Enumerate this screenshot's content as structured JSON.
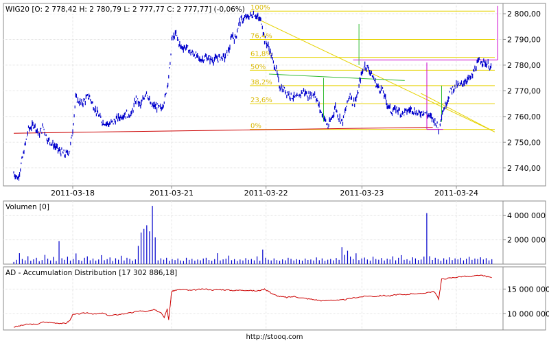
{
  "chart_data": [
    {
      "type": "line",
      "subtype": "ohlc-bars",
      "legend": "WIG20 [O: 2 778,42  H: 2 780,79  L: 2 777,77  C: 2 777,77] (-0,06%)",
      "x_ticks": [
        "2011-03-18",
        "2011-03-21",
        "2011-03-22",
        "2011-03-23",
        "2011-03-24"
      ],
      "y_ticks": [
        "2 740,00",
        "2 750,00",
        "2 760,00",
        "2 770,00",
        "2 780,00",
        "2 790,00",
        "2 800,00"
      ],
      "y_tick_values": [
        2740,
        2750,
        2760,
        2770,
        2780,
        2790,
        2800
      ],
      "ylim": [
        2733,
        2804
      ],
      "grid": true,
      "series_color": "#0000cc",
      "price_path": [
        {
          "t": 0.0,
          "v": 2738
        },
        {
          "t": 0.3,
          "v": 2736
        },
        {
          "t": 0.6,
          "v": 2744
        },
        {
          "t": 1.0,
          "v": 2755
        },
        {
          "t": 1.4,
          "v": 2757
        },
        {
          "t": 1.7,
          "v": 2753
        },
        {
          "t": 2.0,
          "v": 2756
        },
        {
          "t": 2.3,
          "v": 2751
        },
        {
          "t": 2.7,
          "v": 2749
        },
        {
          "t": 3.0,
          "v": 2747
        },
        {
          "t": 3.5,
          "v": 2745
        },
        {
          "t": 3.8,
          "v": 2747
        },
        {
          "t": 4.0,
          "v": 2755
        },
        {
          "t": 4.2,
          "v": 2767
        },
        {
          "t": 4.6,
          "v": 2765
        },
        {
          "t": 5.1,
          "v": 2768
        },
        {
          "t": 5.5,
          "v": 2763
        },
        {
          "t": 6.0,
          "v": 2758
        },
        {
          "t": 6.5,
          "v": 2757
        },
        {
          "t": 7.0,
          "v": 2759
        },
        {
          "t": 7.5,
          "v": 2761
        },
        {
          "t": 8.0,
          "v": 2761
        },
        {
          "t": 8.3,
          "v": 2767
        },
        {
          "t": 8.6,
          "v": 2764
        },
        {
          "t": 9.0,
          "v": 2770
        },
        {
          "t": 9.3,
          "v": 2764
        },
        {
          "t": 9.6,
          "v": 2764
        },
        {
          "t": 10.0,
          "v": 2763
        },
        {
          "t": 10.3,
          "v": 2768
        },
        {
          "t": 10.6,
          "v": 2780
        },
        {
          "t": 10.7,
          "v": 2790
        },
        {
          "t": 11.0,
          "v": 2792
        },
        {
          "t": 11.3,
          "v": 2787
        },
        {
          "t": 11.7,
          "v": 2787
        },
        {
          "t": 12.0,
          "v": 2785
        },
        {
          "t": 12.3,
          "v": 2784
        },
        {
          "t": 12.6,
          "v": 2782
        },
        {
          "t": 13.0,
          "v": 2783
        },
        {
          "t": 13.5,
          "v": 2782
        },
        {
          "t": 14.0,
          "v": 2783
        },
        {
          "t": 14.3,
          "v": 2783
        },
        {
          "t": 14.6,
          "v": 2786
        },
        {
          "t": 14.8,
          "v": 2792
        },
        {
          "t": 15.0,
          "v": 2790
        },
        {
          "t": 15.3,
          "v": 2797
        },
        {
          "t": 15.6,
          "v": 2798
        },
        {
          "t": 16.0,
          "v": 2799
        },
        {
          "t": 16.3,
          "v": 2800
        },
        {
          "t": 16.6,
          "v": 2798
        },
        {
          "t": 16.8,
          "v": 2797
        },
        {
          "t": 17.0,
          "v": 2790
        },
        {
          "t": 17.2,
          "v": 2788
        },
        {
          "t": 17.4,
          "v": 2785
        },
        {
          "t": 17.6,
          "v": 2781
        },
        {
          "t": 17.8,
          "v": 2778
        },
        {
          "t": 18.0,
          "v": 2772
        },
        {
          "t": 18.4,
          "v": 2770
        },
        {
          "t": 18.8,
          "v": 2768
        },
        {
          "t": 19.2,
          "v": 2767
        },
        {
          "t": 19.6,
          "v": 2770
        },
        {
          "t": 20.0,
          "v": 2768
        },
        {
          "t": 20.4,
          "v": 2769
        },
        {
          "t": 20.8,
          "v": 2762
        },
        {
          "t": 21.0,
          "v": 2760
        },
        {
          "t": 21.3,
          "v": 2756
        },
        {
          "t": 21.6,
          "v": 2760
        },
        {
          "t": 21.8,
          "v": 2764
        },
        {
          "t": 22.0,
          "v": 2760
        },
        {
          "t": 22.3,
          "v": 2758
        },
        {
          "t": 22.6,
          "v": 2765
        },
        {
          "t": 22.8,
          "v": 2769
        },
        {
          "t": 23.0,
          "v": 2765
        },
        {
          "t": 23.3,
          "v": 2768
        },
        {
          "t": 23.5,
          "v": 2775
        },
        {
          "t": 23.8,
          "v": 2780
        },
        {
          "t": 24.0,
          "v": 2779
        },
        {
          "t": 24.3,
          "v": 2776
        },
        {
          "t": 24.6,
          "v": 2772
        },
        {
          "t": 25.0,
          "v": 2770
        },
        {
          "t": 25.3,
          "v": 2765
        },
        {
          "t": 25.6,
          "v": 2762
        },
        {
          "t": 26.0,
          "v": 2763
        },
        {
          "t": 26.3,
          "v": 2761
        },
        {
          "t": 26.6,
          "v": 2762
        },
        {
          "t": 27.0,
          "v": 2763
        },
        {
          "t": 27.4,
          "v": 2761
        },
        {
          "t": 27.8,
          "v": 2762
        },
        {
          "t": 28.2,
          "v": 2760
        },
        {
          "t": 28.6,
          "v": 2758
        },
        {
          "t": 28.8,
          "v": 2755
        },
        {
          "t": 29.0,
          "v": 2761
        },
        {
          "t": 29.3,
          "v": 2765
        },
        {
          "t": 29.6,
          "v": 2770
        },
        {
          "t": 30.0,
          "v": 2772
        },
        {
          "t": 30.3,
          "v": 2772
        },
        {
          "t": 30.6,
          "v": 2774
        },
        {
          "t": 31.0,
          "v": 2775
        },
        {
          "t": 31.3,
          "v": 2779
        },
        {
          "t": 31.6,
          "v": 2782
        },
        {
          "t": 31.9,
          "v": 2781
        },
        {
          "t": 32.2,
          "v": 2780
        },
        {
          "t": 32.4,
          "v": 2778
        }
      ],
      "fibonacci": {
        "color": "#e6d200",
        "text_color": "#d9b800",
        "levels": [
          {
            "label": "100%",
            "value": 2801
          },
          {
            "label": "76,4%",
            "value": 2790
          },
          {
            "label": "61,8%",
            "value": 2783
          },
          {
            "label": "50%",
            "value": 2778
          },
          {
            "label": "38,2%",
            "value": 2772
          },
          {
            "label": "23,6%",
            "value": 2765
          },
          {
            "label": "0%",
            "value": 2755
          }
        ]
      },
      "trend_lines": [
        {
          "color": "#e6d200",
          "from": {
            "t": 16.5,
            "v": 2798
          },
          "to": {
            "t": 32.6,
            "v": 2754
          }
        },
        {
          "color": "#e6d200",
          "from": {
            "t": 27.6,
            "v": 2769
          },
          "to": {
            "t": 32.6,
            "v": 2754
          }
        },
        {
          "color": "#cc0000",
          "from": {
            "t": 0.0,
            "v": 2753.5
          },
          "to": {
            "t": 28.4,
            "v": 2755.8
          }
        },
        {
          "color": "#33bb33",
          "from": {
            "t": 17.3,
            "v": 2776.5
          },
          "to": {
            "t": 26.5,
            "v": 2774
          }
        }
      ],
      "marker_lines": [
        {
          "color": "#33bb33",
          "t": 23.4,
          "from": 2780,
          "to": 2796
        },
        {
          "color": "#33bb33",
          "t": 21.0,
          "from": 2758,
          "to": 2775
        },
        {
          "color": "#33bb33",
          "t": 29.0,
          "from": 2758,
          "to": 2772
        },
        {
          "color": "#cc00cc",
          "t": 28.0,
          "from": 2755,
          "to": 2781
        },
        {
          "color": "#cc00cc",
          "t": 32.8,
          "from": 2782,
          "to": 2803
        }
      ]
    },
    {
      "type": "bar",
      "legend": "Volumen [0]",
      "y_ticks": [
        "2 000 000",
        "4 000 000"
      ],
      "y_tick_values": [
        2000000,
        4000000
      ],
      "ylim": [
        0,
        5200000
      ],
      "grid": true,
      "bar_color": "#0000cc",
      "values": [
        180000,
        350000,
        900000,
        420000,
        310000,
        650000,
        280000,
        390000,
        520000,
        240000,
        330000,
        760000,
        450000,
        300000,
        590000,
        260000,
        1900000,
        480000,
        350000,
        610000,
        290000,
        420000,
        880000,
        330000,
        270000,
        520000,
        640000,
        310000,
        460000,
        290000,
        380000,
        740000,
        320000,
        410000,
        550000,
        260000,
        480000,
        360000,
        690000,
        300000,
        520000,
        430000,
        280000,
        390000,
        1500000,
        2600000,
        2900000,
        3200000,
        2700000,
        4800000,
        2200000,
        310000,
        480000,
        360000,
        520000,
        280000,
        410000,
        330000,
        460000,
        300000,
        270000,
        520000,
        350000,
        430000,
        290000,
        380000,
        310000,
        460000,
        520000,
        340000,
        280000,
        410000,
        900000,
        300000,
        390000,
        450000,
        700000,
        320000,
        410000,
        260000,
        380000,
        300000,
        490000,
        350000,
        420000,
        310000,
        640000,
        280000,
        1200000,
        520000,
        360000,
        300000,
        470000,
        330000,
        280000,
        390000,
        310000,
        520000,
        430000,
        300000,
        410000,
        350000,
        290000,
        460000,
        340000,
        380000,
        300000,
        550000,
        320000,
        470000,
        280000,
        360000,
        420000,
        310000,
        500000,
        350000,
        1400000,
        760000,
        1100000,
        620000,
        410000,
        890000,
        330000,
        470000,
        540000,
        380000,
        290000,
        610000,
        420000,
        360000,
        500000,
        300000,
        450000,
        380000,
        640000,
        310000,
        520000,
        740000,
        350000,
        400000,
        290000,
        560000,
        470000,
        330000,
        380000,
        620000,
        4200000,
        650000,
        340000,
        520000,
        410000,
        280000,
        480000,
        360000,
        560000,
        330000,
        470000,
        390000,
        520000,
        310000,
        440000,
        600000,
        350000,
        460000,
        420000,
        560000,
        380000,
        490000,
        310000,
        400000
      ]
    },
    {
      "type": "line",
      "legend": "AD - Accumulation Distribution [17 302 886,18]",
      "y_ticks": [
        "10 000 000",
        "15 000 000"
      ],
      "y_tick_values": [
        10000000,
        15000000
      ],
      "ylim": [
        6700000,
        19500000
      ],
      "grid": true,
      "line_color": "#cc0000",
      "points": [
        {
          "t": 0.0,
          "v": 7300000
        },
        {
          "t": 0.5,
          "v": 7600000
        },
        {
          "t": 1.0,
          "v": 7900000
        },
        {
          "t": 1.5,
          "v": 7800000
        },
        {
          "t": 2.0,
          "v": 8300000
        },
        {
          "t": 2.5,
          "v": 8200000
        },
        {
          "t": 3.0,
          "v": 8100000
        },
        {
          "t": 3.5,
          "v": 8000000
        },
        {
          "t": 3.8,
          "v": 8600000
        },
        {
          "t": 4.0,
          "v": 9800000
        },
        {
          "t": 4.5,
          "v": 10000000
        },
        {
          "t": 5.0,
          "v": 10200000
        },
        {
          "t": 5.5,
          "v": 9900000
        },
        {
          "t": 6.0,
          "v": 10100000
        },
        {
          "t": 6.5,
          "v": 9600000
        },
        {
          "t": 7.0,
          "v": 9800000
        },
        {
          "t": 7.5,
          "v": 10000000
        },
        {
          "t": 8.0,
          "v": 10200000
        },
        {
          "t": 8.5,
          "v": 10600000
        },
        {
          "t": 9.0,
          "v": 10400000
        },
        {
          "t": 9.5,
          "v": 10800000
        },
        {
          "t": 10.0,
          "v": 10200000
        },
        {
          "t": 10.2,
          "v": 9300000
        },
        {
          "t": 10.4,
          "v": 11000000
        },
        {
          "t": 10.5,
          "v": 8800000
        },
        {
          "t": 10.6,
          "v": 11500000
        },
        {
          "t": 10.7,
          "v": 14500000
        },
        {
          "t": 11.0,
          "v": 14800000
        },
        {
          "t": 11.5,
          "v": 14900000
        },
        {
          "t": 12.0,
          "v": 14700000
        },
        {
          "t": 12.5,
          "v": 14900000
        },
        {
          "t": 13.0,
          "v": 15000000
        },
        {
          "t": 13.5,
          "v": 14800000
        },
        {
          "t": 14.0,
          "v": 14900000
        },
        {
          "t": 14.5,
          "v": 14800000
        },
        {
          "t": 15.0,
          "v": 14700000
        },
        {
          "t": 15.5,
          "v": 14800000
        },
        {
          "t": 16.0,
          "v": 14700000
        },
        {
          "t": 16.5,
          "v": 14600000
        },
        {
          "t": 17.0,
          "v": 15000000
        },
        {
          "t": 17.3,
          "v": 14500000
        },
        {
          "t": 17.6,
          "v": 13900000
        },
        {
          "t": 18.0,
          "v": 13500000
        },
        {
          "t": 18.5,
          "v": 13300000
        },
        {
          "t": 19.0,
          "v": 13500000
        },
        {
          "t": 19.5,
          "v": 13200000
        },
        {
          "t": 20.0,
          "v": 13000000
        },
        {
          "t": 20.5,
          "v": 12800000
        },
        {
          "t": 21.0,
          "v": 12600000
        },
        {
          "t": 21.5,
          "v": 12800000
        },
        {
          "t": 22.0,
          "v": 12700000
        },
        {
          "t": 22.5,
          "v": 12900000
        },
        {
          "t": 23.0,
          "v": 13200000
        },
        {
          "t": 23.5,
          "v": 13400000
        },
        {
          "t": 24.0,
          "v": 13600000
        },
        {
          "t": 24.5,
          "v": 13500000
        },
        {
          "t": 25.0,
          "v": 13700000
        },
        {
          "t": 25.5,
          "v": 13600000
        },
        {
          "t": 26.0,
          "v": 13900000
        },
        {
          "t": 26.5,
          "v": 13800000
        },
        {
          "t": 27.0,
          "v": 14100000
        },
        {
          "t": 27.5,
          "v": 14000000
        },
        {
          "t": 28.0,
          "v": 14300000
        },
        {
          "t": 28.5,
          "v": 14500000
        },
        {
          "t": 28.8,
          "v": 13000000
        },
        {
          "t": 29.0,
          "v": 17000000
        },
        {
          "t": 29.5,
          "v": 17200000
        },
        {
          "t": 30.0,
          "v": 17400000
        },
        {
          "t": 30.5,
          "v": 17600000
        },
        {
          "t": 31.0,
          "v": 17500000
        },
        {
          "t": 31.5,
          "v": 17800000
        },
        {
          "t": 32.0,
          "v": 17600000
        },
        {
          "t": 32.4,
          "v": 17300000
        }
      ]
    }
  ],
  "footer": "http://stooq.com"
}
